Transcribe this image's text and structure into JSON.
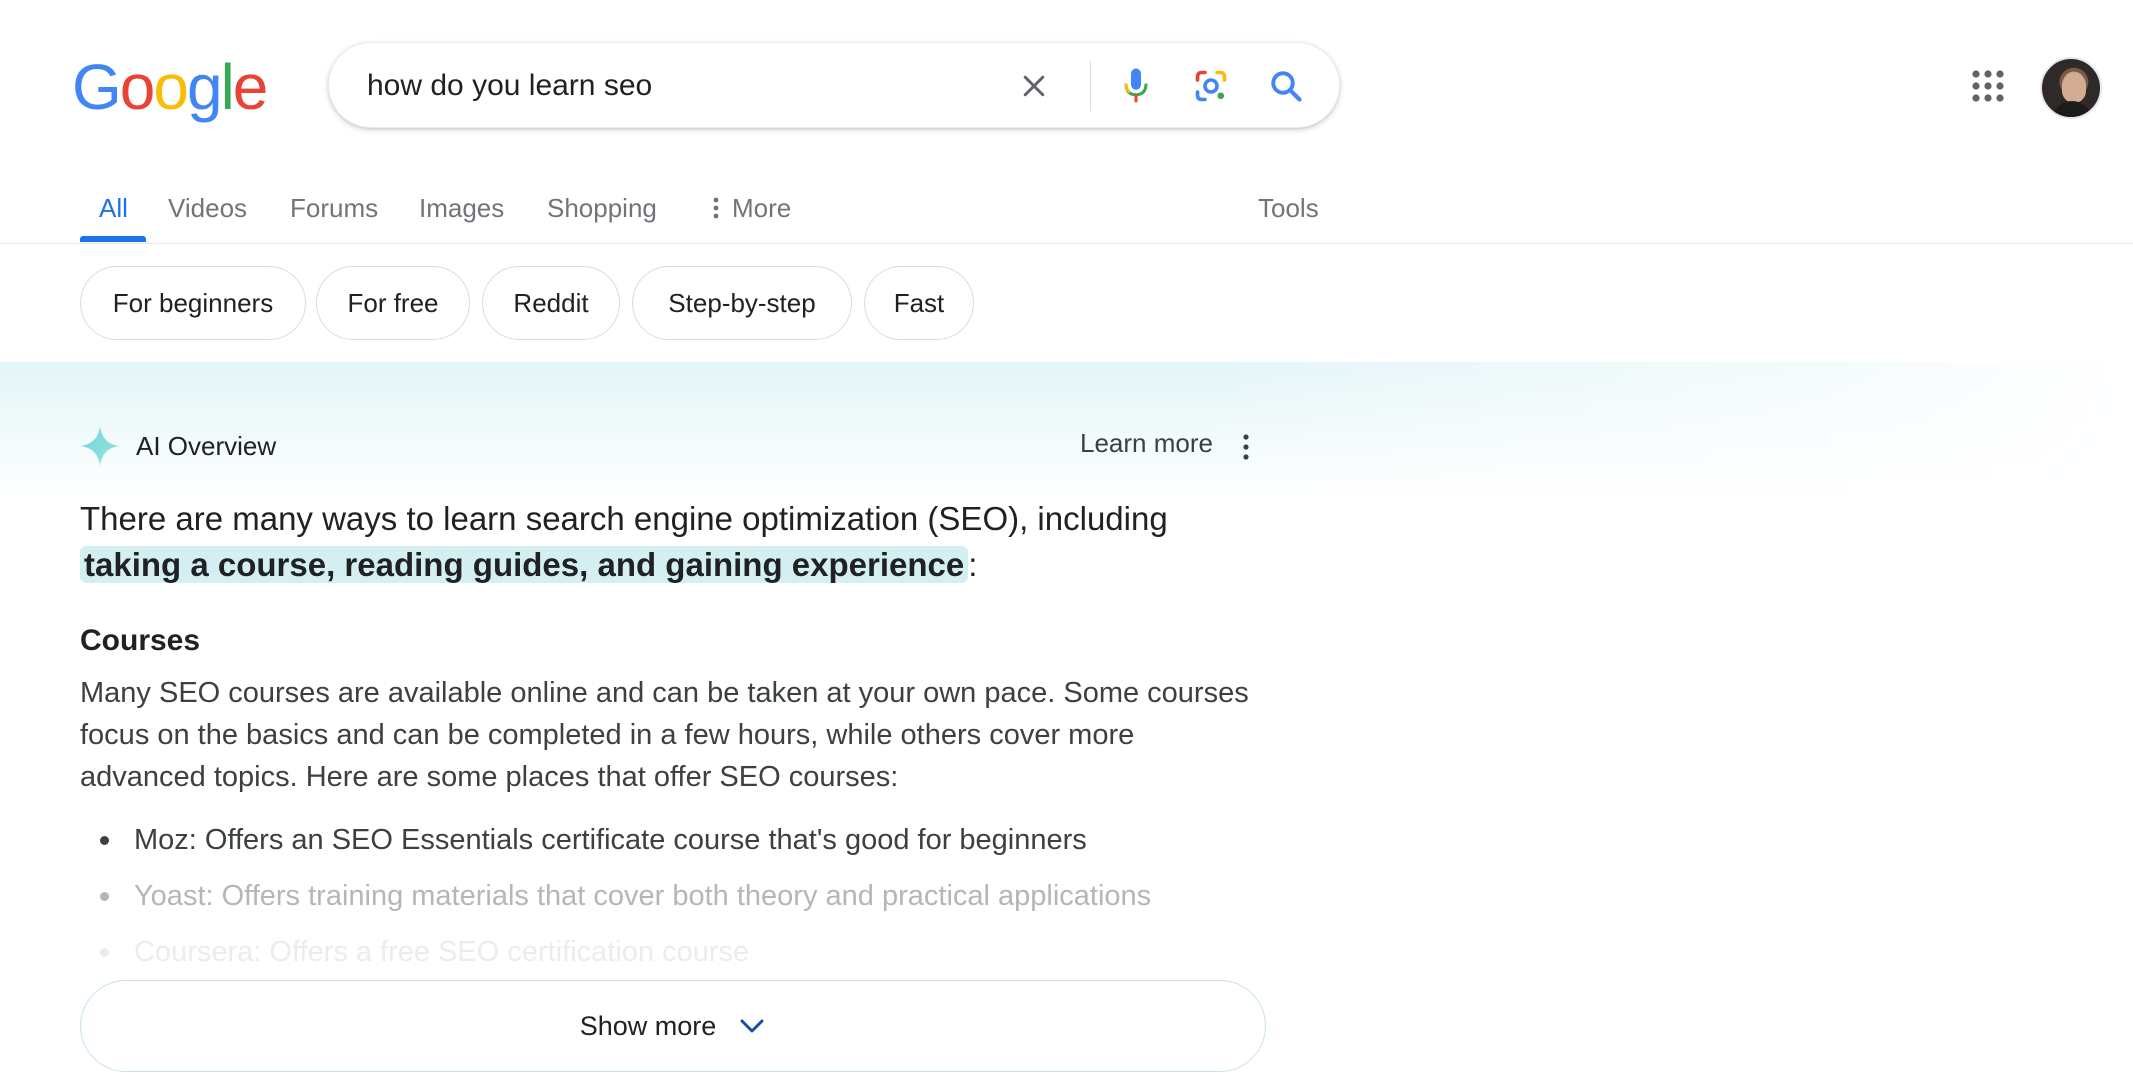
{
  "logo": {
    "letters": [
      "G",
      "o",
      "o",
      "g",
      "l",
      "e"
    ],
    "colors": [
      "#4285F4",
      "#EA4335",
      "#FBBC05",
      "#4285F4",
      "#34A853",
      "#EA4335"
    ]
  },
  "search": {
    "query": "how do you learn seo"
  },
  "tabs": [
    {
      "label": "All",
      "active": true
    },
    {
      "label": "Videos"
    },
    {
      "label": "Forums"
    },
    {
      "label": "Images"
    },
    {
      "label": "Shopping"
    },
    {
      "label": "More"
    }
  ],
  "tools_label": "Tools",
  "chips": [
    "For beginners",
    "For free",
    "Reddit",
    "Step-by-step",
    "Fast"
  ],
  "ai_overview": {
    "title": "AI Overview",
    "learn_more": "Learn more",
    "lead_before": "There are many ways to learn search engine optimization (SEO), including ",
    "lead_highlight": "taking a course, reading guides, and gaining experience",
    "lead_after": ":",
    "section_heading": "Courses",
    "section_text": "Many SEO courses are available online and can be taken at your own pace. Some courses focus on the basics and can be completed in a few hours, while others cover more advanced topics. Here are some places that offer SEO courses:",
    "bullets": [
      "Moz: Offers an SEO Essentials certificate course that's good for beginners",
      "Yoast: Offers training materials that cover both theory and practical applications",
      "Coursera: Offers a free SEO certification course"
    ],
    "show_more": "Show more"
  },
  "colors": {
    "accent": "#1a73e8",
    "ai_highlight": "#d3eff2"
  }
}
